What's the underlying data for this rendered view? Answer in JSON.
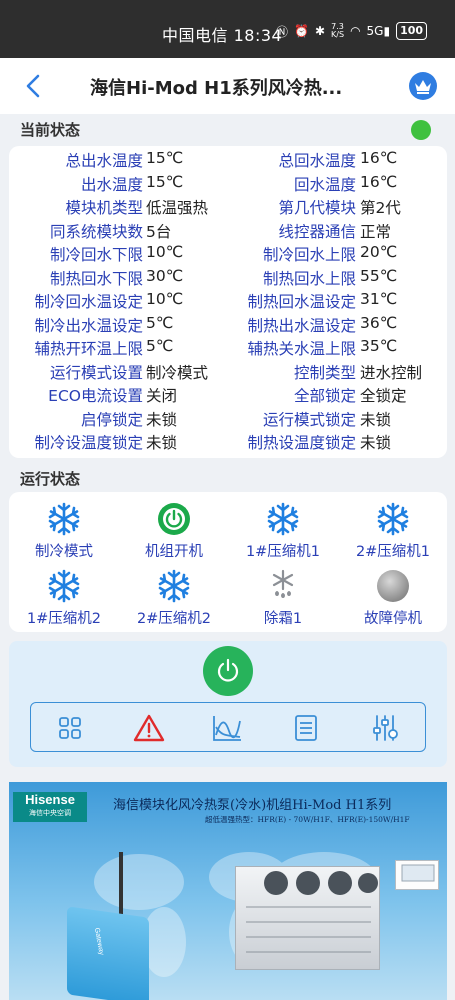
{
  "statusbar": {
    "carrier_time": "中国电信 18:34",
    "speed_value": "7.3",
    "speed_unit": "K/S",
    "network": "5G",
    "battery": "100"
  },
  "header": {
    "title": "海信Hi-Mod H1系列风冷热..."
  },
  "current_status": {
    "title": "当前状态",
    "indicator_color": "#3fc13f",
    "rows": [
      {
        "l1": "总出水温度",
        "v1": "15℃",
        "l2": "总回水温度",
        "v2": "16℃"
      },
      {
        "l1": "出水温度",
        "v1": "15℃",
        "l2": "回水温度",
        "v2": "16℃"
      },
      {
        "l1": "模块机类型",
        "v1": "低温强热",
        "l2": "第几代模块",
        "v2": "第2代"
      },
      {
        "l1": "同系统模块数",
        "v1": "5台",
        "l2": "线控器通信",
        "v2": "正常"
      },
      {
        "l1": "制冷回水下限",
        "v1": "10℃",
        "l2": "制冷回水上限",
        "v2": "20℃"
      },
      {
        "l1": "制热回水下限",
        "v1": "30℃",
        "l2": "制热回水上限",
        "v2": "55℃"
      },
      {
        "l1": "制冷回水温设定",
        "v1": "10℃",
        "l2": "制热回水温设定",
        "v2": "31℃"
      },
      {
        "l1": "制冷出水温设定",
        "v1": "5℃",
        "l2": "制热出水温设定",
        "v2": "36℃"
      },
      {
        "l1": "辅热开环温上限",
        "v1": "5℃",
        "l2": "辅热关水温上限",
        "v2": "35℃"
      },
      {
        "l1": "运行模式设置",
        "v1": "制冷模式",
        "l2": "控制类型",
        "v2": "进水控制"
      },
      {
        "l1": "ECO电流设置",
        "v1": "关闭",
        "l2": "全部锁定",
        "v2": "全锁定"
      },
      {
        "l1": "启停锁定",
        "v1": "未锁",
        "l2": "运行模式锁定",
        "v2": "未锁"
      },
      {
        "l1": "制冷设温度锁定",
        "v1": "未锁",
        "l2": "制热设温度锁定",
        "v2": "未锁"
      }
    ]
  },
  "run_status": {
    "title": "运行状态",
    "items": [
      {
        "label": "制冷模式",
        "icon": "snowflake-icon"
      },
      {
        "label": "机组开机",
        "icon": "power-on-icon"
      },
      {
        "label": "1#压缩机1",
        "icon": "snowflake-icon"
      },
      {
        "label": "2#压缩机1",
        "icon": "snowflake-icon"
      },
      {
        "label": "1#压缩机2",
        "icon": "snowflake-icon"
      },
      {
        "label": "2#压缩机2",
        "icon": "snowflake-icon"
      },
      {
        "label": "除霜1",
        "icon": "defrost-icon"
      },
      {
        "label": "故障停机",
        "icon": "fault-icon"
      }
    ]
  },
  "controls": {
    "power_color": "#27b35b",
    "toolbar": [
      "grid-icon",
      "warning-icon",
      "chart-icon",
      "list-icon",
      "settings-sliders-icon"
    ]
  },
  "banner": {
    "logo": "Hisense",
    "logo_sub": "海信中央空调",
    "title": "海信模块化风冷热泵(冷水)机组Hi-Mod H1系列",
    "subtitle": "超低温强热型：HFR(E) - 70W/H1F、HFR(E)-150W/H1F",
    "gateway_label": "Gateway"
  }
}
